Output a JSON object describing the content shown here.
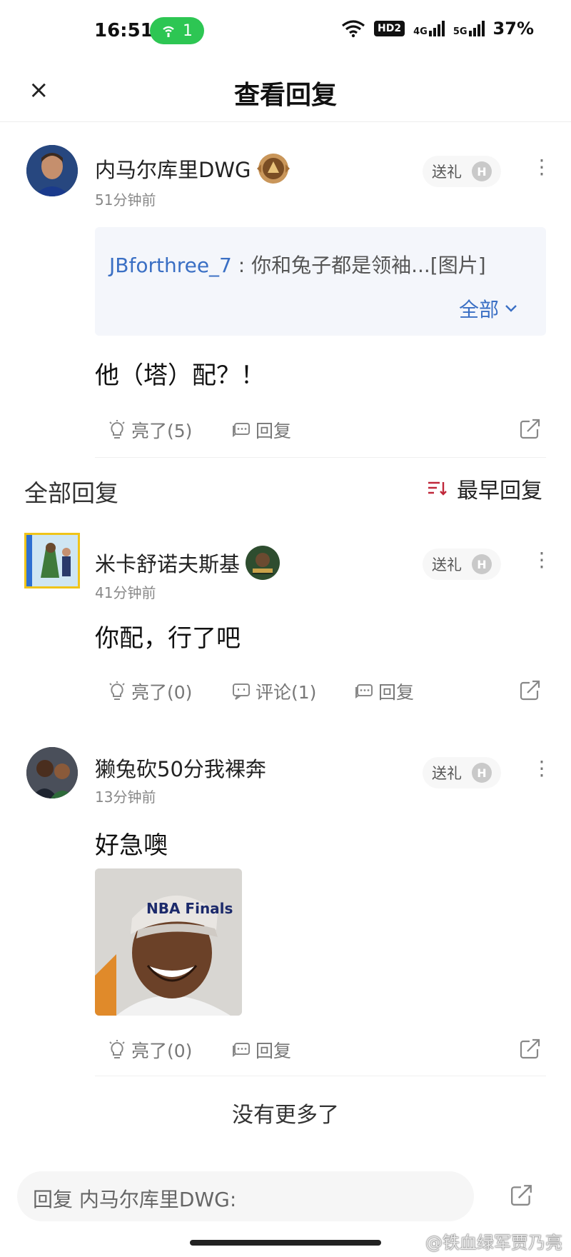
{
  "status_bar": {
    "time": "16:51",
    "hotspot_count": "1",
    "hd": "HD2",
    "net4g": "4G",
    "net5g": "5G",
    "battery": "37%"
  },
  "header": {
    "close": "×",
    "title": "查看回复"
  },
  "main_post": {
    "username": "内马尔库里DWG",
    "time": "51分钟前",
    "gift_label": "送礼",
    "coin": "H",
    "quote_user": "JBforthree_7",
    "quote_sep": " : ",
    "quote_text": "你和兔子都是领袖...[图片]",
    "quote_expand": "全部",
    "content": "他（塔）配？！",
    "like_label": "亮了(5)",
    "reply_label": "回复"
  },
  "section": {
    "title": "全部回复",
    "sort_label": "最早回复"
  },
  "replies": [
    {
      "username": "米卡舒诺夫斯基",
      "time": "41分钟前",
      "gift_label": "送礼",
      "coin": "H",
      "content": "你配，行了吧",
      "like_label": "亮了(0)",
      "comment_label": "评论(1)",
      "reply_label": "回复"
    },
    {
      "username": "獭兔砍50分我裸奔",
      "time": "13分钟前",
      "gift_label": "送礼",
      "coin": "H",
      "content": "好急噢",
      "meme_cap_text": "NBA Finals",
      "like_label": "亮了(0)",
      "reply_label": "回复"
    }
  ],
  "footer": {
    "no_more": "没有更多了",
    "reply_placeholder": "回复 内马尔库里DWG:"
  },
  "watermark": "@铁血绿军贾乃亮",
  "colors": {
    "link": "#3a6fc4",
    "hotspot_green": "#2dc653",
    "sort_red": "#c0283a"
  }
}
